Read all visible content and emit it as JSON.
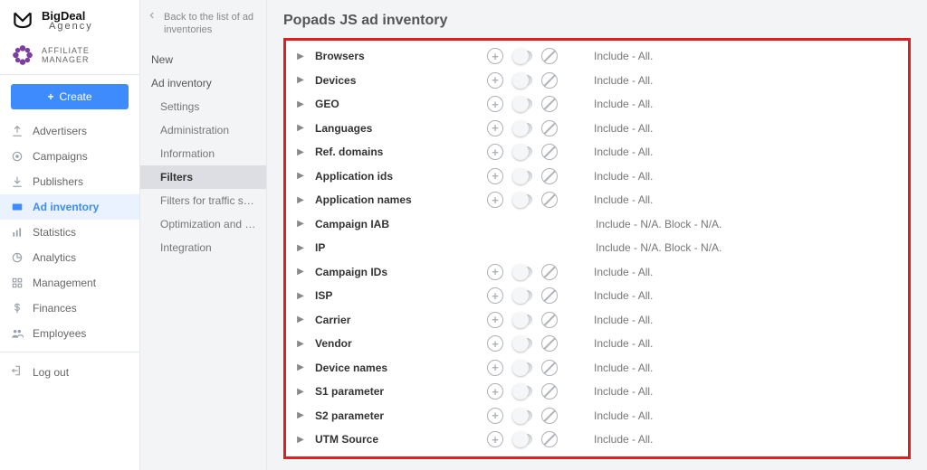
{
  "brand": {
    "name": "BigDeal",
    "sub": "Agency"
  },
  "affiliate_label": "AFFILIATE MANAGER",
  "create_button": "Create",
  "nav": [
    {
      "icon": "upload-icon",
      "label": "Advertisers"
    },
    {
      "icon": "target-icon",
      "label": "Campaigns"
    },
    {
      "icon": "download-icon",
      "label": "Publishers"
    },
    {
      "icon": "ad-icon",
      "label": "Ad inventory",
      "active": true
    },
    {
      "icon": "stats-icon",
      "label": "Statistics"
    },
    {
      "icon": "pie-icon",
      "label": "Analytics"
    },
    {
      "icon": "grid-icon",
      "label": "Management"
    },
    {
      "icon": "dollar-icon",
      "label": "Finances"
    },
    {
      "icon": "people-icon",
      "label": "Employees"
    }
  ],
  "logout_label": "Log out",
  "back_link": "Back to the list of ad inventories",
  "secondary": [
    {
      "label": "New",
      "sub": false
    },
    {
      "label": "Ad inventory",
      "sub": false
    },
    {
      "label": "Settings",
      "sub": true
    },
    {
      "label": "Administration",
      "sub": true
    },
    {
      "label": "Information",
      "sub": true
    },
    {
      "label": "Filters",
      "sub": true,
      "active": true
    },
    {
      "label": "Filters for traffic sour...",
      "sub": true
    },
    {
      "label": "Optimization and rules",
      "sub": true
    },
    {
      "label": "Integration",
      "sub": true
    }
  ],
  "page_title": "Popads JS ad inventory",
  "filters": [
    {
      "label": "Browsers",
      "controls": true,
      "status": "Include - All."
    },
    {
      "label": "Devices",
      "controls": true,
      "status": "Include - All."
    },
    {
      "label": "GEO",
      "controls": true,
      "status": "Include - All."
    },
    {
      "label": "Languages",
      "controls": true,
      "status": "Include - All."
    },
    {
      "label": "Ref. domains",
      "controls": true,
      "status": "Include - All."
    },
    {
      "label": "Application ids",
      "controls": true,
      "status": "Include - All."
    },
    {
      "label": "Application names",
      "controls": true,
      "status": "Include - All."
    },
    {
      "label": "Campaign IAB",
      "controls": false,
      "status": "Include - N/A. Block - N/A."
    },
    {
      "label": "IP",
      "controls": false,
      "status": "Include - N/A. Block - N/A."
    },
    {
      "label": "Campaign IDs",
      "controls": true,
      "status": "Include - All."
    },
    {
      "label": "ISP",
      "controls": true,
      "status": "Include - All."
    },
    {
      "label": "Carrier",
      "controls": true,
      "status": "Include - All."
    },
    {
      "label": "Vendor",
      "controls": true,
      "status": "Include - All."
    },
    {
      "label": "Device names",
      "controls": true,
      "status": "Include - All."
    },
    {
      "label": "S1 parameter",
      "controls": true,
      "status": "Include - All."
    },
    {
      "label": "S2 parameter",
      "controls": true,
      "status": "Include - All."
    },
    {
      "label": "UTM Source",
      "controls": true,
      "status": "Include - All."
    }
  ]
}
